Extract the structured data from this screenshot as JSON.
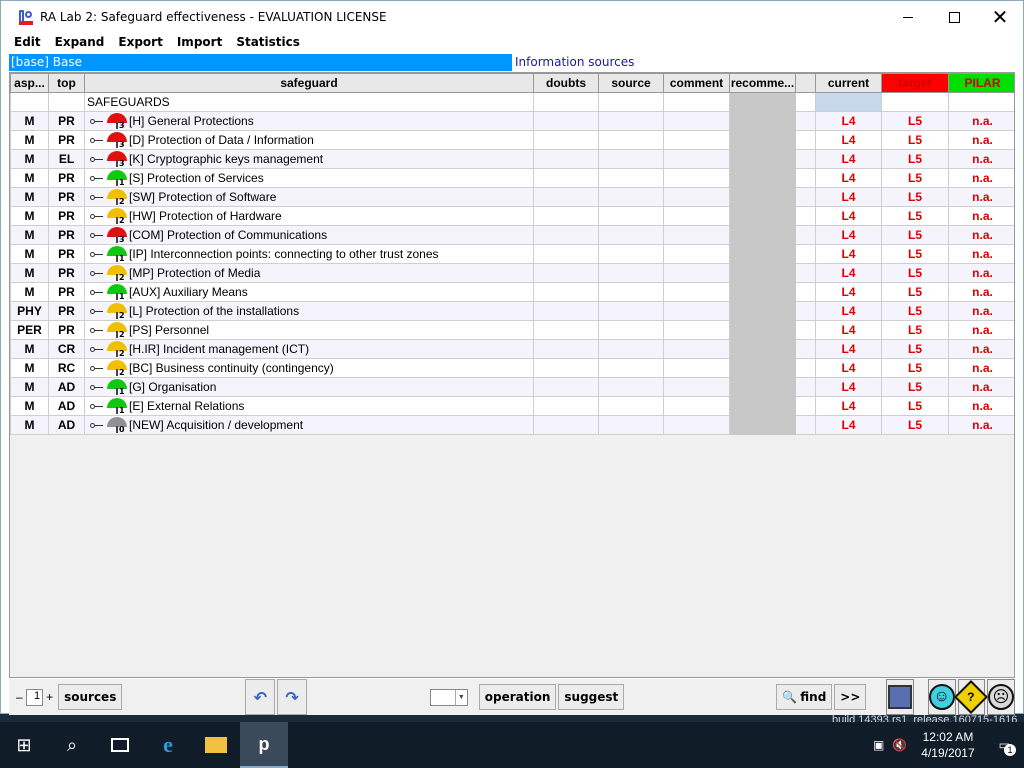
{
  "window": {
    "title": "RA Lab 2: Safeguard effectiveness - EVALUATION LICENSE"
  },
  "menu": [
    "Edit",
    "Expand",
    "Export",
    "Import",
    "Statistics"
  ],
  "infobar": {
    "base": "[base] Base",
    "sources": "Information sources"
  },
  "columns": {
    "asp": "asp...",
    "top": "top",
    "safeguard": "safeguard",
    "doubts": "doubts",
    "source": "source",
    "comment": "comment",
    "recommend": "recomme...",
    "current": "current",
    "target": "target",
    "pilar": "PILAR"
  },
  "root_label": "SAFEGUARDS",
  "rows": [
    {
      "asp": "M",
      "top": "PR",
      "name": "[H] General Protections",
      "color": "#e01010",
      "num": "3",
      "current": "L4",
      "target": "L5",
      "pilar": "n.a."
    },
    {
      "asp": "M",
      "top": "PR",
      "name": "[D] Protection of Data / Information",
      "color": "#e01010",
      "num": "3",
      "current": "L4",
      "target": "L5",
      "pilar": "n.a."
    },
    {
      "asp": "M",
      "top": "EL",
      "name": "[K] Cryptographic keys management",
      "color": "#e01010",
      "num": "3",
      "current": "L4",
      "target": "L5",
      "pilar": "n.a."
    },
    {
      "asp": "M",
      "top": "PR",
      "name": "[S] Protection of Services",
      "color": "#10c810",
      "num": "1",
      "current": "L4",
      "target": "L5",
      "pilar": "n.a."
    },
    {
      "asp": "M",
      "top": "PR",
      "name": "[SW] Protection of Software",
      "color": "#f0c000",
      "num": "2",
      "current": "L4",
      "target": "L5",
      "pilar": "n.a."
    },
    {
      "asp": "M",
      "top": "PR",
      "name": "[HW] Protection of Hardware",
      "color": "#f0c000",
      "num": "2",
      "current": "L4",
      "target": "L5",
      "pilar": "n.a."
    },
    {
      "asp": "M",
      "top": "PR",
      "name": "[COM] Protection of Communications",
      "color": "#e01010",
      "num": "3",
      "current": "L4",
      "target": "L5",
      "pilar": "n.a."
    },
    {
      "asp": "M",
      "top": "PR",
      "name": "[IP] Interconnection points: connecting to other trust zones",
      "color": "#10c810",
      "num": "1",
      "current": "L4",
      "target": "L5",
      "pilar": "n.a."
    },
    {
      "asp": "M",
      "top": "PR",
      "name": "[MP] Protection of Media",
      "color": "#f0c000",
      "num": "2",
      "current": "L4",
      "target": "L5",
      "pilar": "n.a."
    },
    {
      "asp": "M",
      "top": "PR",
      "name": "[AUX] Auxiliary Means",
      "color": "#10c810",
      "num": "1",
      "current": "L4",
      "target": "L5",
      "pilar": "n.a."
    },
    {
      "asp": "PHY",
      "top": "PR",
      "name": "[L] Protection of the installations",
      "color": "#f0c000",
      "num": "2",
      "current": "L4",
      "target": "L5",
      "pilar": "n.a."
    },
    {
      "asp": "PER",
      "top": "PR",
      "name": "[PS] Personnel",
      "color": "#f0c000",
      "num": "2",
      "current": "L4",
      "target": "L5",
      "pilar": "n.a."
    },
    {
      "asp": "M",
      "top": "CR",
      "name": "[H.IR] Incident management (ICT)",
      "color": "#f0c000",
      "num": "2",
      "current": "L4",
      "target": "L5",
      "pilar": "n.a."
    },
    {
      "asp": "M",
      "top": "RC",
      "name": "[BC] Business continuity (contingency)",
      "color": "#f0c000",
      "num": "2",
      "current": "L4",
      "target": "L5",
      "pilar": "n.a."
    },
    {
      "asp": "M",
      "top": "AD",
      "name": "[G] Organisation",
      "color": "#10c810",
      "num": "1",
      "current": "L4",
      "target": "L5",
      "pilar": "n.a."
    },
    {
      "asp": "M",
      "top": "AD",
      "name": "[E] External Relations",
      "color": "#10c810",
      "num": "1",
      "current": "L4",
      "target": "L5",
      "pilar": "n.a."
    },
    {
      "asp": "M",
      "top": "AD",
      "name": "[NEW] Acquisition / development",
      "color": "#909090",
      "num": "0",
      "current": "L4",
      "target": "L5",
      "pilar": "n.a."
    }
  ],
  "bottom": {
    "minus": "–",
    "page": "1",
    "plus": "+",
    "sources": "sources",
    "undo": "↶",
    "redo": "↷",
    "operation": "operation",
    "suggest": "suggest",
    "find": "find",
    "more": ">>"
  },
  "taskbar": {
    "time": "12:02 AM",
    "date": "4/19/2017",
    "build": "build 14393.rs1_release.160715-1616",
    "notifications": "1"
  }
}
